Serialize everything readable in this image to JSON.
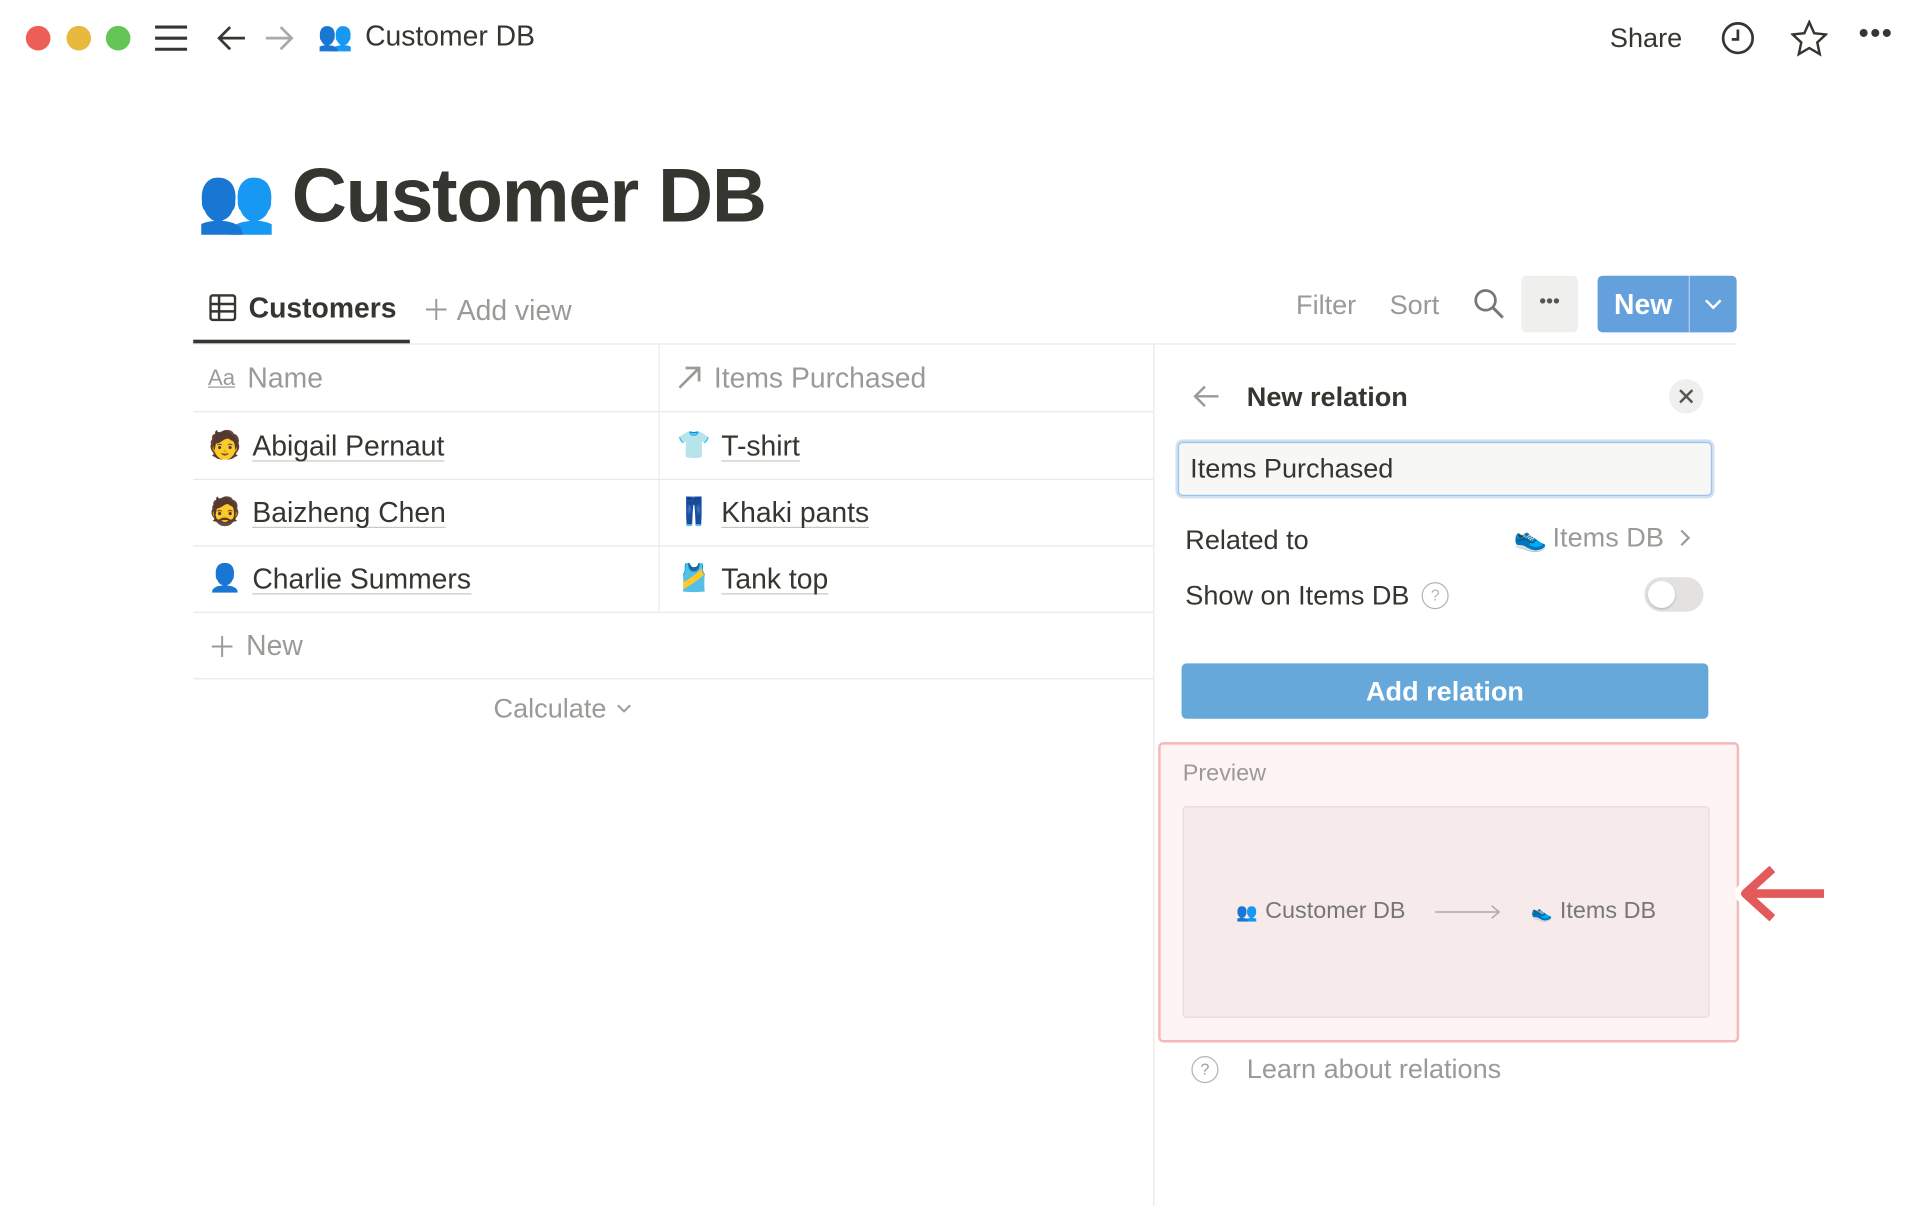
{
  "window": {
    "traffic_lights": [
      "#ec5f57",
      "#e8b93f",
      "#62c554"
    ],
    "breadcrumb_icon": "people-emoji",
    "breadcrumb": "Customer DB",
    "share": "Share"
  },
  "page": {
    "title": "Customer DB",
    "icon": "people-emoji"
  },
  "views": {
    "active": "Customers",
    "add_view": "Add view",
    "filter": "Filter",
    "sort": "Sort",
    "new": "New",
    "accent": "#2f80d1"
  },
  "table": {
    "columns": [
      {
        "label": "Name",
        "icon": "Aa"
      },
      {
        "label": "Items Purchased",
        "icon": "arrow-up-right"
      }
    ],
    "rows": [
      {
        "name": "Abigail Pernaut",
        "item": "T-shirt",
        "item_icon": "👕"
      },
      {
        "name": "Baizheng Chen",
        "item": "Khaki pants",
        "item_icon": "👖"
      },
      {
        "name": "Charlie Summers",
        "item": "Tank top",
        "item_icon": "🎽"
      }
    ],
    "new_row": "New",
    "calculate": "Calculate"
  },
  "panel": {
    "title": "New relation",
    "name_value": "Items Purchased",
    "related_label": "Related to",
    "related_value": "Items DB",
    "show_label": "Show on Items DB",
    "show_toggle": false,
    "add_button": "Add relation",
    "add_color": "#66a8d9",
    "preview_label": "Preview",
    "preview_from": "Customer DB",
    "preview_to": "Items DB",
    "learn": "Learn about relations",
    "highlight_color": "#f4b8b8"
  }
}
